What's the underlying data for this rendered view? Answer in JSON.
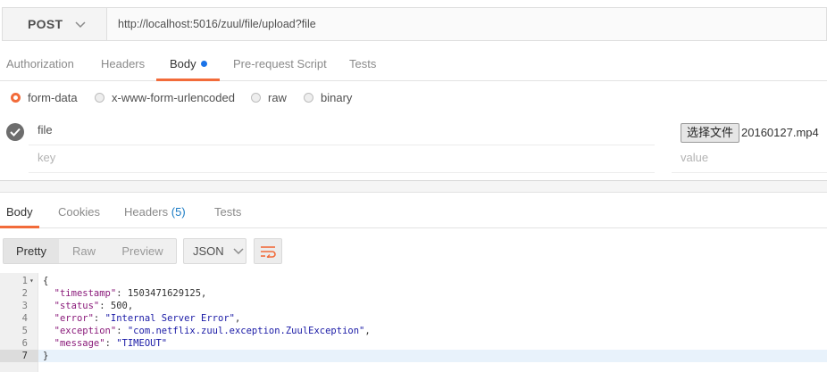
{
  "request": {
    "method": "POST",
    "url": "http://localhost:5016/zuul/file/upload?file"
  },
  "request_tabs": [
    {
      "label": "Authorization"
    },
    {
      "label": "Headers"
    },
    {
      "label": "Body",
      "active": true,
      "has_dot": true
    },
    {
      "label": "Pre-request Script"
    },
    {
      "label": "Tests"
    }
  ],
  "body_types": [
    {
      "label": "form-data",
      "selected": true
    },
    {
      "label": "x-www-form-urlencoded"
    },
    {
      "label": "raw"
    },
    {
      "label": "binary"
    }
  ],
  "form_rows": [
    {
      "key": "file",
      "checked": true,
      "file_button": "选择文件",
      "file_name": "20160127.mp4"
    },
    {
      "key_placeholder": "key",
      "value_placeholder": "value"
    }
  ],
  "response_tabs": [
    {
      "label": "Body",
      "active": true
    },
    {
      "label": "Cookies"
    },
    {
      "label": "Headers",
      "count": "(5)"
    },
    {
      "label": "Tests"
    }
  ],
  "view_modes": [
    {
      "label": "Pretty",
      "active": true
    },
    {
      "label": "Raw"
    },
    {
      "label": "Preview"
    }
  ],
  "format": "JSON",
  "response_lines": [
    {
      "num": "1",
      "fold": "▾",
      "text": "{"
    },
    {
      "num": "2",
      "key": "\"timestamp\"",
      "value": "1503471629125",
      "vtype": "n",
      "comma": ","
    },
    {
      "num": "3",
      "key": "\"status\"",
      "value": "500",
      "vtype": "n",
      "comma": ","
    },
    {
      "num": "4",
      "key": "\"error\"",
      "value": "\"Internal Server Error\"",
      "vtype": "s",
      "comma": ","
    },
    {
      "num": "5",
      "key": "\"exception\"",
      "value": "\"com.netflix.zuul.exception.ZuulException\"",
      "vtype": "s",
      "comma": ","
    },
    {
      "num": "6",
      "key": "\"message\"",
      "value": "\"TIMEOUT\"",
      "vtype": "s",
      "comma": ""
    },
    {
      "num": "7",
      "text": "}",
      "highlight": true
    }
  ],
  "colors": {
    "accent": "#f26b3a",
    "dot": "#1a73e8",
    "json_key": "#8a1a7a",
    "json_string": "#1a1aa6"
  },
  "icons": {
    "method_dropdown": "chevron-down-icon",
    "check": "check-circle-icon",
    "format_dropdown": "chevron-down-icon",
    "wrap": "wrap-lines-icon"
  }
}
